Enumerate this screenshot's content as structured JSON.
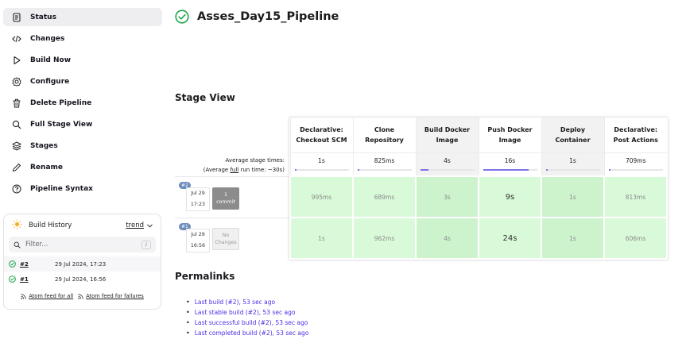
{
  "sidebar": {
    "items": [
      {
        "label": "Status",
        "icon": "status-icon",
        "active": true
      },
      {
        "label": "Changes",
        "icon": "code-icon"
      },
      {
        "label": "Build Now",
        "icon": "play-icon"
      },
      {
        "label": "Configure",
        "icon": "gear-icon"
      },
      {
        "label": "Delete Pipeline",
        "icon": "trash-icon"
      },
      {
        "label": "Full Stage View",
        "icon": "search-icon"
      },
      {
        "label": "Stages",
        "icon": "layers-icon"
      },
      {
        "label": "Rename",
        "icon": "pencil-icon"
      },
      {
        "label": "Pipeline Syntax",
        "icon": "help-icon"
      }
    ]
  },
  "build_history": {
    "title": "Build History",
    "trend_label": "trend",
    "filter_placeholder": "Filter...",
    "filter_shortcut": "/",
    "builds": [
      {
        "number": "#2",
        "date": "29 Jul 2024, 17:23",
        "status": "success"
      },
      {
        "number": "#1",
        "date": "29 Jul 2024, 16:56",
        "status": "success"
      }
    ],
    "feed_all": "Atom feed for all",
    "feed_failures": "Atom feed for failures"
  },
  "page": {
    "title": "Asses_Day15_Pipeline",
    "status_color": "#1ea64b"
  },
  "stage_view": {
    "heading": "Stage View",
    "avg_label": "Average stage times:",
    "avg_full_prefix": "(Average ",
    "avg_full_word": "full",
    "avg_full_suffix": " run time: ~30s)",
    "stages": [
      {
        "name1": "Declarative:",
        "name2": "Checkout SCM",
        "avg": "1s",
        "bar_fraction": 0.03
      },
      {
        "name1": "Clone",
        "name2": "Repository",
        "avg": "825ms",
        "bar_fraction": 0.04
      },
      {
        "name1": "Build Docker",
        "name2": "Image",
        "avg": "4s",
        "bar_fraction": 0.16
      },
      {
        "name1": "Push Docker",
        "name2": "Image",
        "avg": "16s",
        "bar_fraction": 0.85
      },
      {
        "name1": "Deploy",
        "name2": "Container",
        "avg": "1s",
        "bar_fraction": 0.04
      },
      {
        "name1": "Declarative:",
        "name2": "Post Actions",
        "avg": "709ms",
        "bar_fraction": 0.03
      }
    ],
    "runs": [
      {
        "badge": "#2",
        "date": "Jul 29",
        "time": "17:23",
        "changes_line1": "1",
        "changes_line2": "commit",
        "changes_style": "dark",
        "times": [
          "995ms",
          "689ms",
          "3s",
          "9s",
          "1s",
          "813ms"
        ]
      },
      {
        "badge": "#1",
        "date": "Jul 29",
        "time": "16:56",
        "changes_line1": "No",
        "changes_line2": "Changes",
        "changes_style": "light",
        "times": [
          "1s",
          "962ms",
          "4s",
          "24s",
          "1s",
          "606ms"
        ]
      }
    ]
  },
  "permalinks": {
    "heading": "Permalinks",
    "links": [
      "Last build (#2), 53 sec ago",
      "Last stable build (#2), 53 sec ago",
      "Last successful build (#2), 53 sec ago",
      "Last completed build (#2), 53 sec ago"
    ]
  }
}
